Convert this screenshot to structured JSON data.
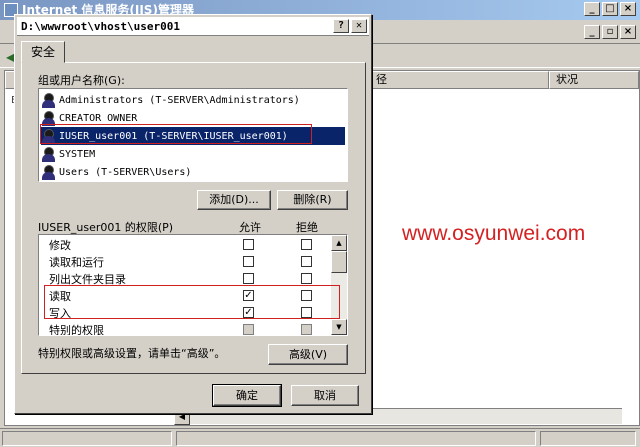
{
  "background_window": {
    "title": "Internet 信息服务(IIS)管理器",
    "list_headers": [
      "径",
      "状况"
    ],
    "left_label": "E"
  },
  "dialog": {
    "title": "D:\\wwwroot\\vhost\\user001",
    "help_label": "?",
    "close_label": "✕",
    "tab_label": "安全",
    "users_label": "组或用户名称(G):",
    "users": [
      {
        "name": "Administrators (T-SERVER\\Administrators)",
        "selected": false
      },
      {
        "name": "CREATOR OWNER",
        "selected": false
      },
      {
        "name": "IUSER_user001 (T-SERVER\\IUSER_user001)",
        "selected": true
      },
      {
        "name": "SYSTEM",
        "selected": false
      },
      {
        "name": "Users (T-SERVER\\Users)",
        "selected": false
      }
    ],
    "add_label": "添加(D)...",
    "remove_label": "删除(R)",
    "permissions_label": "IUSER_user001 的权限(P)",
    "allow_header": "允许",
    "deny_header": "拒绝",
    "permissions": [
      {
        "name": "修改",
        "allow": false,
        "deny": false,
        "disabled": false
      },
      {
        "name": "读取和运行",
        "allow": false,
        "deny": false,
        "disabled": false
      },
      {
        "name": "列出文件夹目录",
        "allow": false,
        "deny": false,
        "disabled": false
      },
      {
        "name": "读取",
        "allow": true,
        "deny": false,
        "disabled": false
      },
      {
        "name": "写入",
        "allow": true,
        "deny": false,
        "disabled": false
      },
      {
        "name": "特别的权限",
        "allow": false,
        "deny": false,
        "disabled": true
      }
    ],
    "advanced_hint": "特别权限或高级设置，请单击“高级”。",
    "advanced_label": "高级(V)",
    "ok_label": "确定",
    "cancel_label": "取消"
  },
  "watermark": "www.osyunwei.com",
  "colors": {
    "selection": "#0a246a",
    "highlight_outline": "#d02020",
    "watermark": "#d42121"
  }
}
